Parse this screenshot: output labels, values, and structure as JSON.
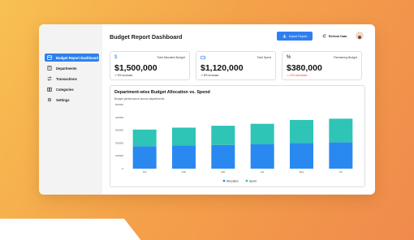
{
  "window": {
    "title": "Budget Report Dashboard"
  },
  "sidebar": {
    "items": [
      {
        "label": "Budget Report Dashboard",
        "icon": "dashboard-icon",
        "active": true
      },
      {
        "label": "Departments",
        "icon": "building-icon",
        "active": false
      },
      {
        "label": "Transactions",
        "icon": "transactions-icon",
        "active": false
      },
      {
        "label": "Categories",
        "icon": "book-icon",
        "active": false
      },
      {
        "label": "Settings",
        "icon": "gear-icon",
        "active": false
      }
    ]
  },
  "header": {
    "export_label": "Export Report",
    "refresh_label": "Refresh Data"
  },
  "cards": [
    {
      "icon": "$",
      "label": "Total Allocated Budget",
      "value": "$1,500,000",
      "note": "↗ 5% increase",
      "note_color": "#333333"
    },
    {
      "icon": "wallet",
      "label": "Total Spent",
      "value": "$1,120,000",
      "note": "↗ 8% increase",
      "note_color": "#333333"
    },
    {
      "icon": "%",
      "label": "Remaining Budget",
      "value": "$380,000",
      "note": "↘ 10% decrease",
      "note_color": "#e04848"
    }
  ],
  "chart": {
    "title": "Department-wise Budget Allocation vs. Spend",
    "subtitle": "Budget performance across departments"
  },
  "chart_data": {
    "type": "bar",
    "stacked": true,
    "categories": [
      "Jan",
      "Feb",
      "Mar",
      "Apr",
      "May",
      "Jun"
    ],
    "series": [
      {
        "name": "Allocated",
        "color": "#2a89f0",
        "values": [
          175000,
          180000,
          185000,
          190000,
          200000,
          205000
        ]
      },
      {
        "name": "Spent",
        "color": "#2ec4b6",
        "values": [
          130000,
          140000,
          150000,
          160000,
          180000,
          185000
        ]
      }
    ],
    "y_ticks": [
      "0",
      "100000",
      "200000",
      "300000",
      "400000",
      "500000"
    ],
    "ylim": [
      0,
      500000
    ],
    "legend": "bottom",
    "grid": false
  }
}
